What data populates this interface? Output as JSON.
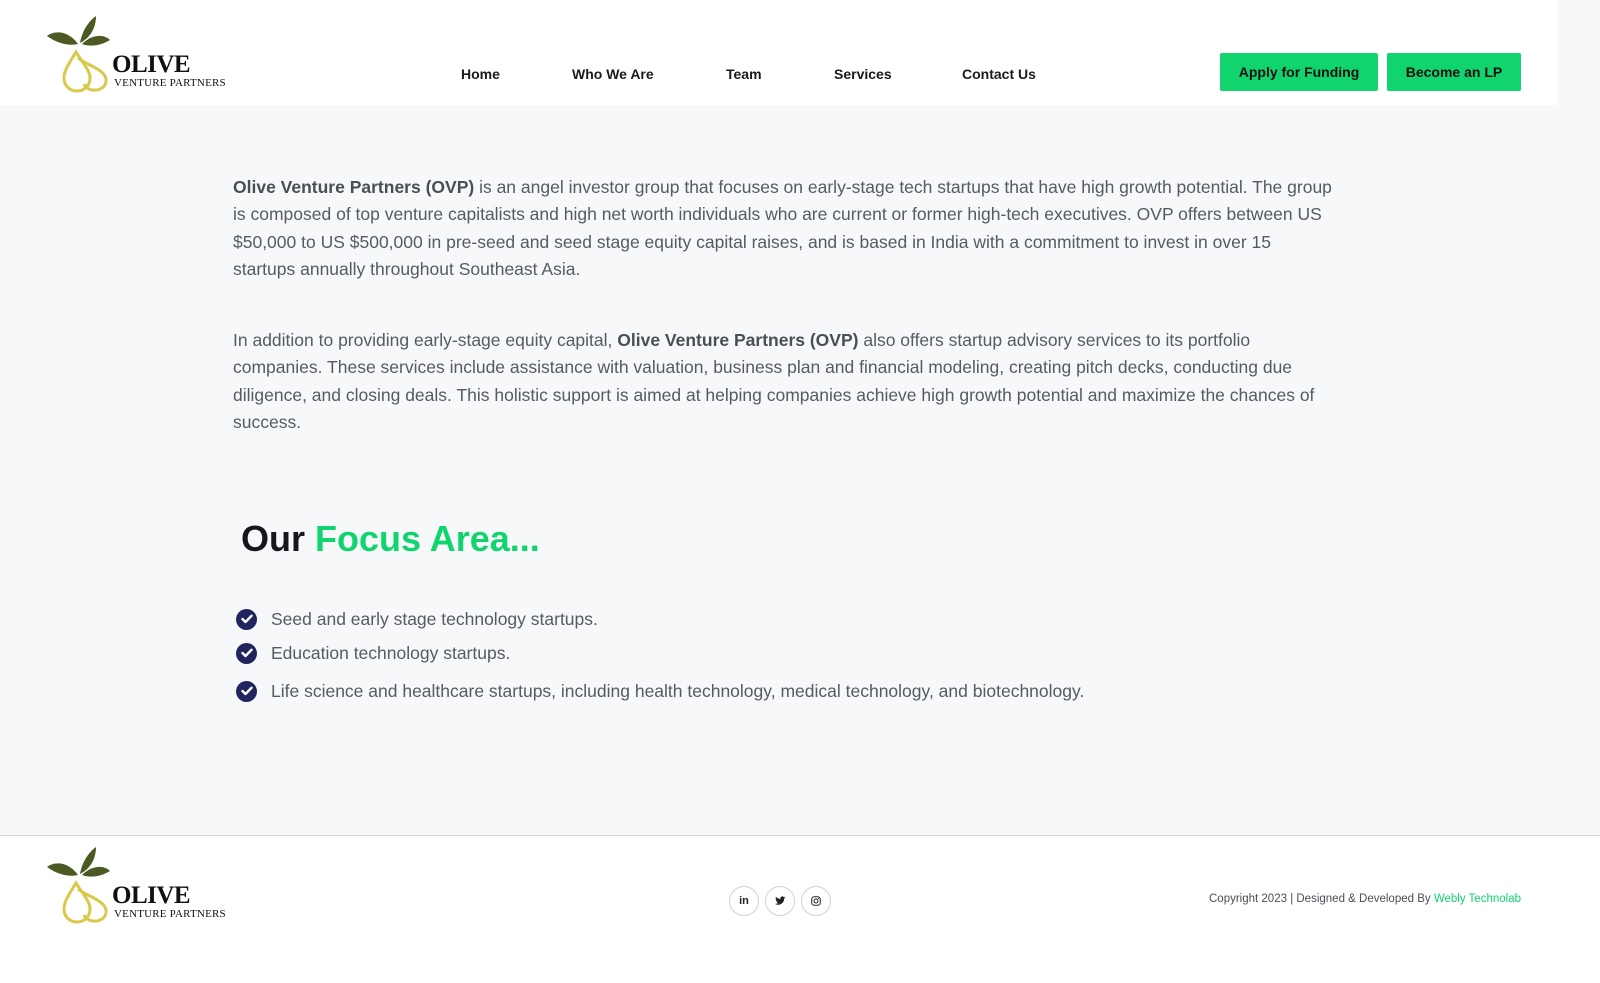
{
  "brand": {
    "name": "OLIVE",
    "tagline": "VENTURE PARTNERS"
  },
  "nav": {
    "items": [
      {
        "label": "Home"
      },
      {
        "label": "Who We Are"
      },
      {
        "label": "Team"
      },
      {
        "label": "Services"
      },
      {
        "label": "Contact Us"
      }
    ]
  },
  "header_buttons": {
    "apply": "Apply for Funding",
    "lp": "Become an LP"
  },
  "intro": {
    "p1_bold": "Olive Venture Partners (OVP)",
    "p1_rest": " is an angel investor group that focuses on early-stage tech startups that have high growth potential. The group is composed of top venture capitalists and high net worth individuals who are current or former high-tech executives. OVP offers between US $50,000 to US $500,000 in pre-seed and seed stage equity capital raises, and is based in India with a commitment to invest in over 15 startups annually throughout Southeast Asia.",
    "p2_start": "In addition to providing early-stage equity capital, ",
    "p2_bold": "Olive Venture Partners (OVP)",
    "p2_rest": " also offers startup advisory services to its portfolio companies. These services include assistance with valuation, business plan and financial modeling, creating pitch decks, conducting due diligence, and closing deals. This holistic support is aimed at helping companies achieve high growth potential and maximize the chances of success."
  },
  "focus": {
    "title_part1": "Our",
    "title_part2": "Focus Area...",
    "items": [
      "Seed and early stage technology startups.",
      "Education technology startups.",
      "Life science and healthcare startups, including health technology, medical technology, and biotechnology."
    ]
  },
  "footer": {
    "social": [
      {
        "icon": "linkedin-icon",
        "glyph": "in"
      },
      {
        "icon": "twitter-icon",
        "glyph": ""
      },
      {
        "icon": "instagram-icon",
        "glyph": ""
      }
    ],
    "copyright": "Copyright 2023 | Designed & Developed By ",
    "developer": "Webly Technolab"
  },
  "colors": {
    "accent": "#11d46f",
    "check": "#21255e",
    "leaf": "#4a5a22",
    "drop": "#d8c94a"
  }
}
